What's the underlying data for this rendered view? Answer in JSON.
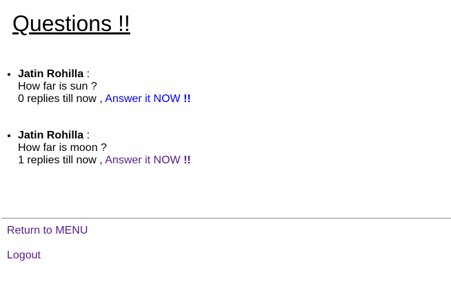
{
  "page": {
    "title": "Questions !!"
  },
  "questions": [
    {
      "author": "Jatin Rohilla",
      "separator": " :",
      "text": "How far is sun ?",
      "replies": "0 replies till now , ",
      "answer_label": "Answer it NOW ",
      "answer_bang": "!!"
    },
    {
      "author": "Jatin Rohilla",
      "separator": " :",
      "text": "How far is moon ?",
      "replies": "1 replies till now , ",
      "answer_label": "Answer it NOW ",
      "answer_bang": "!!"
    }
  ],
  "footer": {
    "menu_label": "Return to MENU",
    "logout_label": "Logout"
  },
  "colors": {
    "link_unvisited": "#0000ee",
    "link_visited": "#551a8b"
  }
}
